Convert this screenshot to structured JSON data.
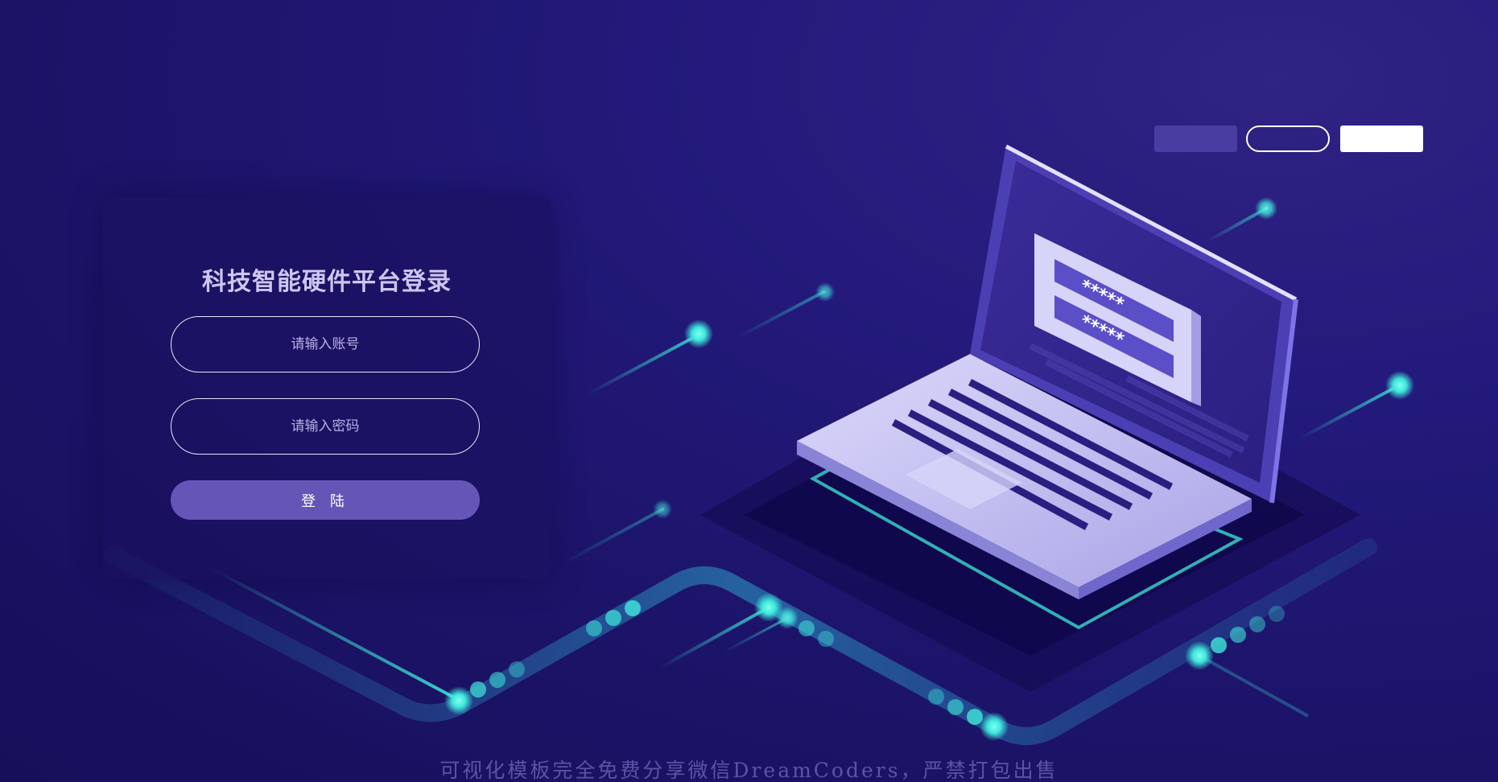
{
  "login": {
    "title": "科技智能硬件平台登录",
    "account_placeholder": "请输入账号",
    "password_placeholder": "请输入密码",
    "submit_label": "登 陆"
  },
  "top_buttons": [
    "",
    "",
    ""
  ],
  "illustration": {
    "password_mask_1": "*****",
    "password_mask_2": "*****"
  },
  "footer": {
    "text": "可视化模板完全免费分享微信DreamCoders，严禁打包出售"
  },
  "colors": {
    "background": "#1d1566",
    "accent": "#6555b6",
    "glow": "#3ee7dc",
    "laptop": "#c6c2f2"
  }
}
